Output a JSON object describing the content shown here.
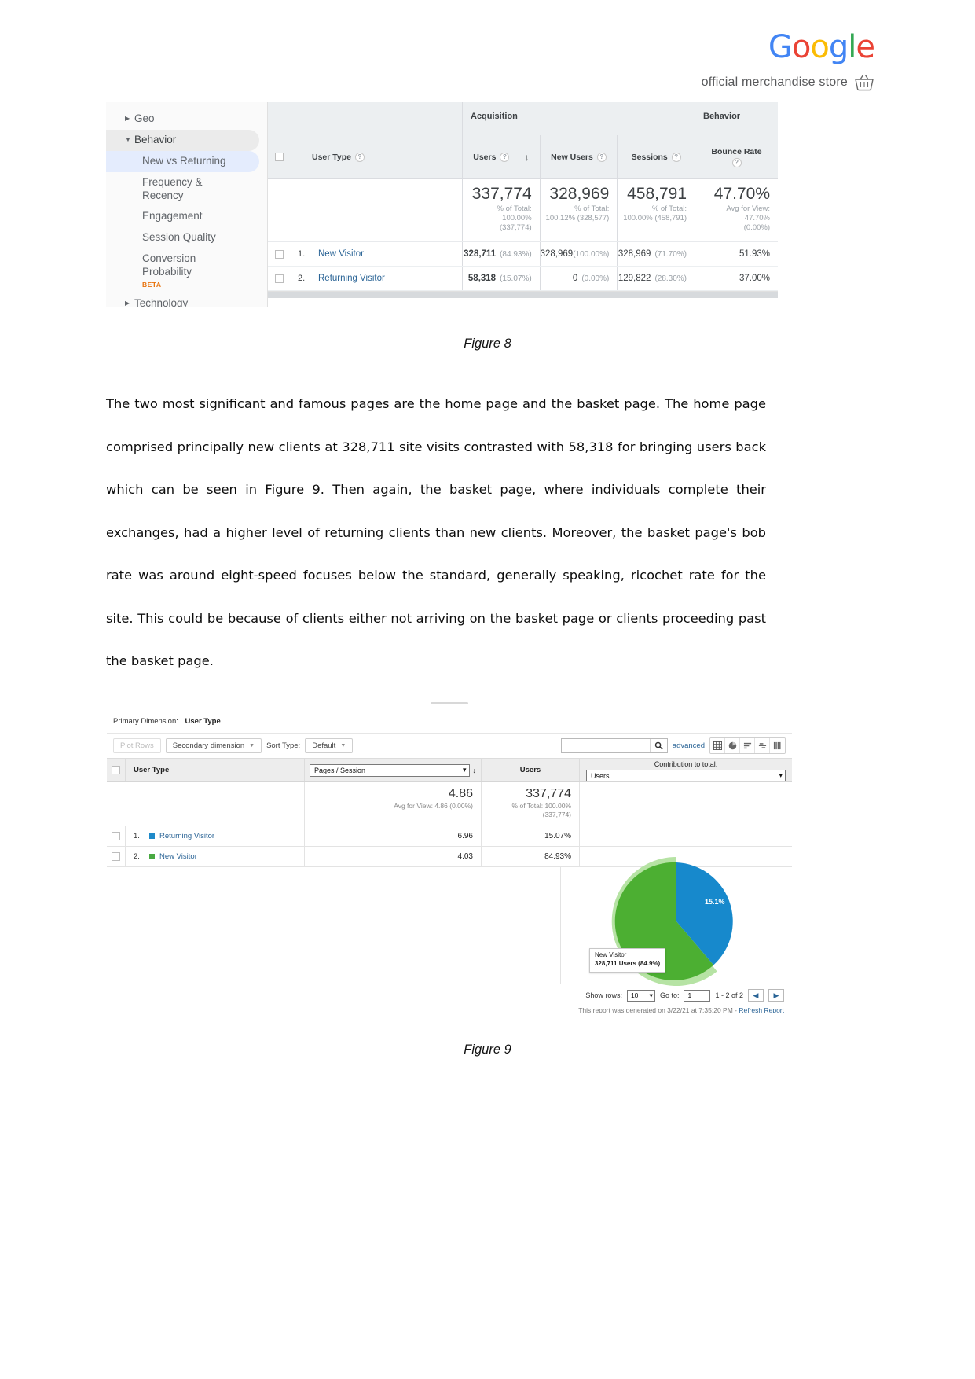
{
  "brand": {
    "logo_letters": [
      {
        "ch": "G",
        "color": "#4285F4"
      },
      {
        "ch": "o",
        "color": "#EA4335"
      },
      {
        "ch": "o",
        "color": "#FBBC05"
      },
      {
        "ch": "g",
        "color": "#4285F4"
      },
      {
        "ch": "l",
        "color": "#34A853"
      },
      {
        "ch": "e",
        "color": "#EA4335"
      }
    ],
    "tagline": "official merchandise store",
    "basket_icon": "shopping-basket-icon"
  },
  "figure8": {
    "sidebar": {
      "items": [
        {
          "label": "Geo",
          "type": "group",
          "expanded": false
        },
        {
          "label": "Behavior",
          "type": "group",
          "expanded": true
        },
        {
          "label": "New vs Returning",
          "type": "sub",
          "selected": true
        },
        {
          "label": "Frequency & Recency",
          "type": "sub",
          "selected": false
        },
        {
          "label": "Engagement",
          "type": "sub",
          "selected": false
        },
        {
          "label": "Session Quality",
          "type": "sub",
          "selected": false
        },
        {
          "label": "Conversion Probability",
          "type": "sub",
          "selected": false,
          "badge": "BETA"
        },
        {
          "label": "Technology",
          "type": "group",
          "expanded": false
        }
      ]
    },
    "table": {
      "group_headers": [
        {
          "label": "Acquisition"
        },
        {
          "label": "Behavior"
        }
      ],
      "columns": [
        {
          "label": "User Type",
          "has_help": true,
          "sorted": false
        },
        {
          "label": "Users",
          "has_help": true,
          "sorted": true,
          "sort_dir": "desc"
        },
        {
          "label": "New Users",
          "has_help": true,
          "sorted": false
        },
        {
          "label": "Sessions",
          "has_help": true,
          "sorted": false
        },
        {
          "label": "Bounce Rate",
          "has_help": true,
          "sorted": false
        }
      ],
      "summary": [
        {
          "value": "337,774",
          "note1": "% of Total: 100.00%",
          "note2": "(337,774)"
        },
        {
          "value": "328,969",
          "note1": "% of Total:",
          "note2": "100.12% (328,577)"
        },
        {
          "value": "458,791",
          "note1": "% of Total:",
          "note2": "100.00% (458,791)"
        },
        {
          "value": "47.70%",
          "note1": "Avg for View:",
          "note2": "47.70%",
          "note3": "(0.00%)"
        }
      ],
      "rows": [
        {
          "index": "1.",
          "dimension": "New Visitor",
          "users": "328,711",
          "users_pct": "(84.93%)",
          "new_users": "328,969",
          "new_users_pct": "(100.00%)",
          "sessions": "328,969",
          "sessions_pct": "(71.70%)",
          "bounce_rate": "51.93%"
        },
        {
          "index": "2.",
          "dimension": "Returning Visitor",
          "users": "58,318",
          "users_pct": "(15.07%)",
          "new_users": "0",
          "new_users_pct": "(0.00%)",
          "sessions": "129,822",
          "sessions_pct": "(28.30%)",
          "bounce_rate": "37.00%"
        }
      ]
    },
    "caption": "Figure 8"
  },
  "paragraph": "The two most significant and famous pages are the home page and the basket page. The home page comprised principally new clients at 328,711 site visits contrasted with 58,318 for bringing users back which can be seen in Figure 9. Then again, the basket page, where individuals complete their exchanges, had a higher level of returning clients than new clients. Moreover, the basket page's bob rate was around eight-speed focuses below the standard, generally speaking, ricochet rate for the site. This could be because of clients either not arriving on the basket page or clients proceeding past the basket page.",
  "figure9": {
    "primary_dimension_label": "Primary Dimension:",
    "primary_dimension_value": "User Type",
    "toolbar": {
      "plot_rows": "Plot Rows",
      "secondary_dimension": "Secondary dimension",
      "sort_type_label": "Sort Type:",
      "sort_type_value": "Default",
      "search_value": "",
      "search_placeholder": "",
      "advanced": "advanced",
      "view_icons": [
        "table-view-icon",
        "pie-view-icon",
        "performance-view-icon",
        "comparison-view-icon",
        "pivot-view-icon"
      ]
    },
    "table": {
      "dimension_header": "User Type",
      "metric_select": "Pages / Session",
      "users_header": "Users",
      "contribution_title": "Contribution to total:",
      "contribution_select": "Users",
      "summary": {
        "pages_session": "4.86",
        "pages_session_note": "Avg for View: 4.86 (0.00%)",
        "users": "337,774",
        "users_note1": "% of Total: 100.00%",
        "users_note2": "(337,774)"
      },
      "rows": [
        {
          "index": "1.",
          "label": "Returning Visitor",
          "color": "#1f8ac9",
          "pages_session": "6.96",
          "users": "15.07%"
        },
        {
          "index": "2.",
          "label": "New Visitor",
          "color": "#49a942",
          "pages_session": "4.03",
          "users": "84.93%"
        }
      ]
    },
    "pie": {
      "slice_label": "15.1%",
      "tooltip_title": "New Visitor",
      "tooltip_value": "328,711 Users (84.9%)",
      "new_color": "#4CAF32",
      "returning_color": "#1789CC",
      "halo_color": "#b6e3a4"
    },
    "footer": {
      "show_rows_label": "Show rows:",
      "show_rows_value": "10",
      "go_to_label": "Go to:",
      "go_to_value": "1",
      "range": "1 - 2 of 2",
      "prev_icon": "chevron-left-icon",
      "next_icon": "chevron-right-icon",
      "generated": "This report was generated on 3/22/21 at 7:35:20 PM - ",
      "refresh_link": "Refresh Report"
    },
    "caption": "Figure 9"
  },
  "chart_data": {
    "type": "pie",
    "title": "Contribution to total: Users",
    "categories": [
      "New Visitor",
      "Returning Visitor"
    ],
    "values": [
      328711,
      58318
    ],
    "percentages": [
      84.9,
      15.1
    ],
    "colors": [
      "#4CAF32",
      "#1789CC"
    ],
    "labels_shown": [
      "15.1%"
    ],
    "legend_position": "table-left",
    "annotations": [
      "New Visitor 328,711 Users (84.9%)"
    ]
  }
}
